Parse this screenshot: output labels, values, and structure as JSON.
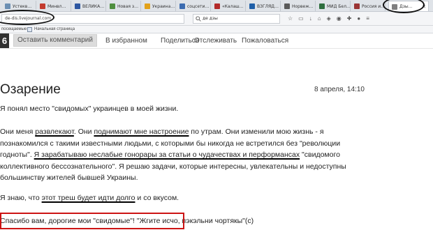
{
  "tabs": [
    {
      "label": "Устекв…",
      "color": "#6b8fb3"
    },
    {
      "label": "Минвл…",
      "color": "#c33b2e"
    },
    {
      "label": "ВЕЛИКА…",
      "color": "#2c56a1"
    },
    {
      "label": "Новая з…",
      "color": "#4f8f3f"
    },
    {
      "label": "Украина…",
      "color": "#e2a11a"
    },
    {
      "label": "соцсети…",
      "color": "#3b6bb0"
    },
    {
      "label": "«Калаш…",
      "color": "#b32a2a"
    },
    {
      "label": "ВЗГЛЯД…",
      "color": "#1f5fa8"
    },
    {
      "label": "Норвеж…",
      "color": "#5a5a5a"
    },
    {
      "label": "МИД Бел…",
      "color": "#2f6f3f"
    },
    {
      "label": "Россия и…",
      "color": "#9a3434"
    },
    {
      "label": "Дзы…",
      "color": "#7f7f7f",
      "active": true
    }
  ],
  "browser": {
    "url": "de-dis.livejournal.com",
    "search": "де дзы",
    "bookmarks": {
      "often": "посещаемые",
      "home": "Начальная страница"
    }
  },
  "toolbar": {
    "badge": "6",
    "comment_button": "Оставить комментарий",
    "favorites": "В избранном",
    "share": "Поделиться",
    "track": "Отслеживать",
    "complain": "Пожаловаться"
  },
  "post": {
    "title": "Озарение",
    "date": "8 апреля, 14:10",
    "p1": "Я понял место \"свидомых\" украинцев в моей жизни.",
    "p2": {
      "a": "Они меня ",
      "b": "развлекают",
      "c": ". Они ",
      "d": "поднимают мне настроение",
      "e": " по утрам. Они изменили мою жизнь - я",
      "line2": "познакомился с такими известными людьми, с которыми бы никогда не встретился без \"революции",
      "line3a": "годноты\". ",
      "line3b": "Я зарабатываю неслабые гонорары за статьи о чудачествах и перформансах",
      "line3c": " \"свидомого",
      "line4": "коллективного бессознательного\". Я решаю задачи, которые интересны, увлекательны и недоступны",
      "line5": "большинству жителей бывшей Украины."
    },
    "p3": {
      "a": "Я знаю, что ",
      "b": "этот треш будет идти долго",
      "c": " и со вкусом."
    },
    "p4": {
      "a": "Спасибо вам, дорогие мои \"свидомые\"! \"Жгите исчо",
      "b": ", пэкэльни чортякы\"(с)"
    }
  }
}
